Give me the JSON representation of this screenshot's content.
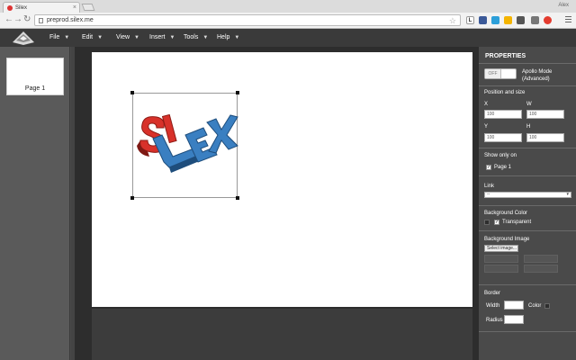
{
  "browser": {
    "tab_title": "Silex",
    "tab_close": "×",
    "user_name": "Alex",
    "url": "preprod.silex.me",
    "back": "←",
    "forward": "→",
    "reload": "↻",
    "star": "☆",
    "extensions": [
      {
        "name": "L",
        "color": "#ffffff",
        "text_color": "#333333"
      },
      {
        "name": "",
        "color": "#3b5998",
        "text_color": "#ffffff"
      },
      {
        "name": "",
        "color": "#2c9fd9",
        "text_color": "#ffffff"
      },
      {
        "name": "",
        "color": "#f4b400",
        "text_color": "#ffffff"
      },
      {
        "name": "",
        "color": "#555555",
        "text_color": "#ffffff"
      },
      {
        "name": "",
        "color": "#e33b2e",
        "text_color": "#ffffff"
      }
    ]
  },
  "menu": [
    "File",
    "Edit",
    "View",
    "Insert",
    "Tools",
    "Help"
  ],
  "pages": [
    {
      "label": "Page 1"
    }
  ],
  "properties": {
    "title": "PROPERTIES",
    "apollo_toggle": "OFF",
    "apollo_label": "Apollo Mode (Advanced)",
    "position_title": "Position and size",
    "x_label": "X",
    "x_value": "100",
    "w_label": "W",
    "w_value": "100",
    "y_label": "Y",
    "y_value": "100",
    "h_label": "H",
    "h_value": "100",
    "show_only_title": "Show only on",
    "show_only_page": "Page 1",
    "link_title": "Link",
    "link_value": "--",
    "bg_color_title": "Background Color",
    "transparent_label": "Transparent",
    "bg_image_title": "Background Image",
    "select_image": "Select image...",
    "border_title": "Border",
    "width_label": "Width",
    "color_label": "Color",
    "radius_label": "Radius"
  },
  "colors": {
    "logo_red": "#d8312a",
    "logo_blue": "#3a7fc1"
  }
}
